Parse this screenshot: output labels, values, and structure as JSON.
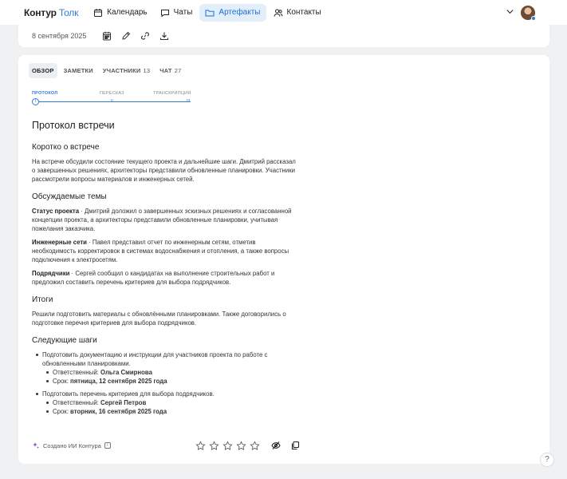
{
  "header": {
    "logo_main": "Контур",
    "logo_accent": "Толк",
    "nav": [
      {
        "label": "Календарь",
        "icon": "calendar-icon"
      },
      {
        "label": "Чаты",
        "icon": "chat-icon"
      },
      {
        "label": "Артефакты",
        "icon": "folder-icon",
        "active": true
      },
      {
        "label": "Контакты",
        "icon": "contacts-icon"
      }
    ]
  },
  "meeting": {
    "date": "8 сентября 2025"
  },
  "tabs": [
    {
      "label": "ОБЗОР",
      "count": ""
    },
    {
      "label": "ЗАМЕТКИ",
      "count": ""
    },
    {
      "label": "УЧАСТНИКИ",
      "count": "13"
    },
    {
      "label": "ЧАТ",
      "count": "27"
    }
  ],
  "stepper": {
    "steps": [
      "ПРОТОКОЛ",
      "ПЕРЕСКАЗ",
      "ТРАНСКРИПЦИЯ"
    ],
    "marks": [
      "I",
      "II",
      "III"
    ]
  },
  "protocol": {
    "title": "Протокол встречи",
    "summary_heading": "Коротко о встрече",
    "summary_text": "На встрече обсудили состояние текущего проекта и дальнейшие шаги. Дмитрий рассказал о завершенных решениях, архитекторы представили обновленные планировки. Участники рассмотрели вопросы материалов и инженерных сетей.",
    "topics_heading": "Обсуждаемые темы",
    "topics": [
      {
        "title": "Статус проекта",
        "text": " · Дмитрий доложил о завершенных эскизных решениях и согласованной концепции проекта, а архитекторы представили обновленные планировки, учитывая пожелания заказчика."
      },
      {
        "title": "Инженерные сети",
        "text": " · Павел представил отчет по инженерным сетям, отметив необходимость корректировок в системах водоснабжения и отопления, а также вопросы подключения к электросетям."
      },
      {
        "title": "Подрядчики",
        "text": " · Сергей сообщил о кандидатах на выполнение строительных работ и предложил составить перечень критериев для выбора подрядчиков."
      }
    ],
    "results_heading": "Итоги",
    "results_text": "Решили подготовить материалы с обновлёнными планировками. Также договорились о подготовке перечня критериев для выбора подрядчиков.",
    "next_heading": "Следующие шаги",
    "next_steps": [
      {
        "text": "Подготовить документацию и инструкции для участников проекта по работе с обновленными планировками.",
        "owner_label": "Ответственный: ",
        "owner": "Ольга Смирнова",
        "due_label": "Срок: ",
        "due": "пятница, 12 сентября 2025 года"
      },
      {
        "text": "Подготовить перечень критериев для выбора подрядчиков.",
        "owner_label": "Ответственный: ",
        "owner": "Сергей Петров",
        "due_label": "Срок: ",
        "due": "вторник, 16 сентября 2025 года"
      }
    ]
  },
  "footer": {
    "ai_note": "Создано ИИ Контура",
    "info_glyph": "i",
    "rating_max": 5,
    "rating_value": 0
  },
  "help_glyph": "?",
  "colors": {
    "accent": "#2f7bd6",
    "active_tab_bg": "#e3eefb",
    "page_bg": "#f0f1f2"
  }
}
